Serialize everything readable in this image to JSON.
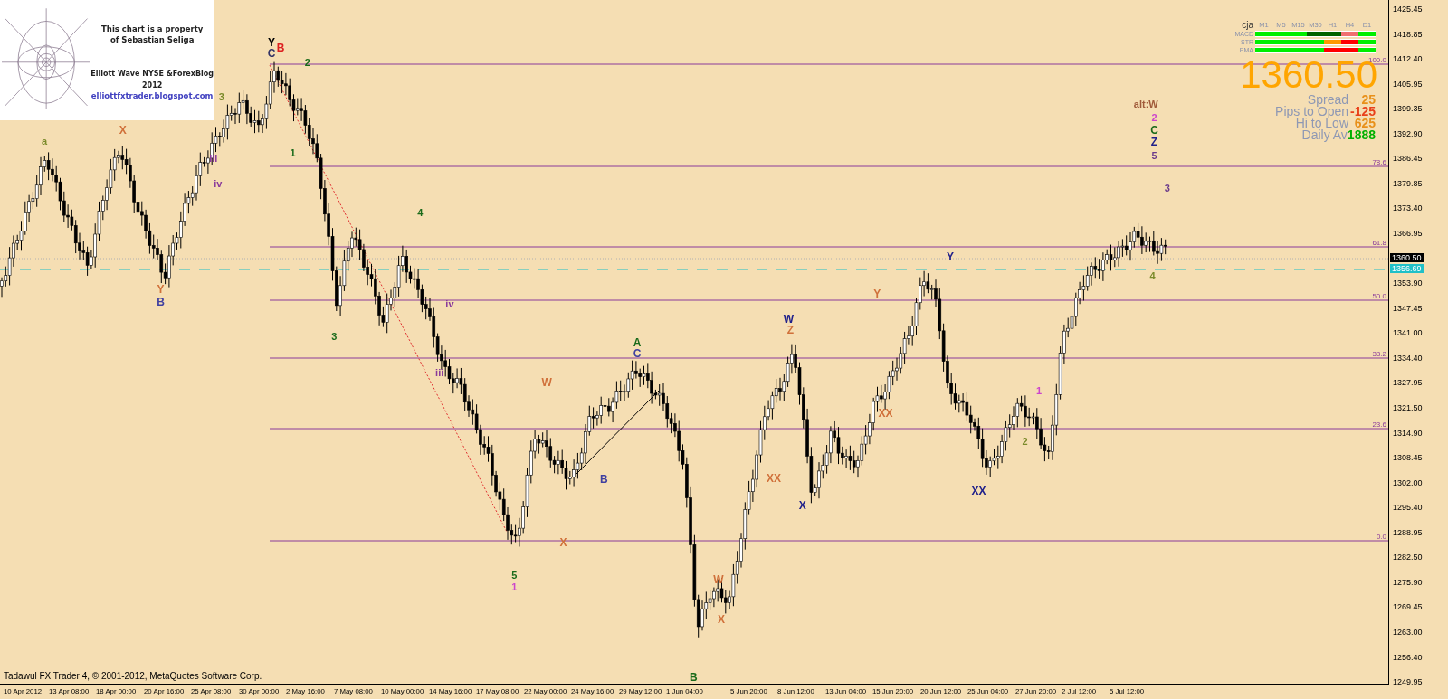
{
  "credit_box": {
    "notice": "This chart is a property of Sebastian Seliga",
    "blog_name": "Elliott Wave NYSE &ForexBlog",
    "year": "2012",
    "url": "elliottfxtrader.blogspot.com"
  },
  "info_panel": {
    "symbol": "cja",
    "timeframes": [
      "M1",
      "M5",
      "M15",
      "M30",
      "H1",
      "H4",
      "D1"
    ],
    "rows": [
      {
        "name": "MACD",
        "cells": [
          {
            "color": "#00ee00"
          },
          {
            "color": "#00ee00"
          },
          {
            "color": "#00ee00"
          },
          {
            "color": "#006400"
          },
          {
            "color": "#006400"
          },
          {
            "color": "#f07070"
          },
          {
            "color": "#00ee00"
          }
        ]
      },
      {
        "name": "STR",
        "cells": [
          {
            "color": "#00ee00"
          },
          {
            "color": "#00ee00"
          },
          {
            "color": "#00ee00"
          },
          {
            "color": "#00ee00"
          },
          {
            "color": "#ff9900"
          },
          {
            "color": "#ff0000"
          },
          {
            "color": "#00ee00"
          }
        ]
      },
      {
        "name": "EMA",
        "cells": [
          {
            "color": "#00ee00"
          },
          {
            "color": "#00ee00"
          },
          {
            "color": "#00ee00"
          },
          {
            "color": "#00ee00"
          },
          {
            "color": "#ff0000"
          },
          {
            "color": "#ff0000"
          },
          {
            "color": "#00ee00"
          }
        ]
      }
    ],
    "price": "1360.50",
    "stats": [
      {
        "label": "Spread",
        "value": "25",
        "color": "#e8901a"
      },
      {
        "label": "Pips to Open",
        "value": "-125",
        "color": "#e8401a"
      },
      {
        "label": "Hi to Low",
        "value": "625",
        "color": "#e8901a"
      },
      {
        "label": "Daily Av",
        "value": "1888",
        "color": "#00b000"
      }
    ]
  },
  "fib_levels": [
    {
      "label": "100.0"
    },
    {
      "label": "78.6"
    },
    {
      "label": "61.8"
    },
    {
      "label": "50.0"
    },
    {
      "label": "38.2"
    },
    {
      "label": "23.6"
    },
    {
      "label": "0.0"
    }
  ],
  "wave_labels": [
    {
      "text": "Y",
      "color": "#000000"
    },
    {
      "text": "B",
      "color": "#dd2020"
    },
    {
      "text": "C",
      "color": "#333366"
    },
    {
      "text": "X",
      "color": "#d0703a"
    },
    {
      "text": "Y",
      "color": "#d0703a"
    },
    {
      "text": "B",
      "color": "#4040a0"
    },
    {
      "text": "a",
      "color": "#7a8a2a"
    },
    {
      "text": "3",
      "color": "#7a8a2a"
    },
    {
      "text": "2",
      "color": "#1a6a1a"
    },
    {
      "text": "1",
      "color": "#1a6a1a"
    },
    {
      "text": "4",
      "color": "#1a6a1a"
    },
    {
      "text": "3",
      "color": "#1a6a1a"
    },
    {
      "text": "5",
      "color": "#1a6a1a"
    },
    {
      "text": "1",
      "color": "#cc44cc"
    },
    {
      "text": "A",
      "color": "#1a6a1a"
    },
    {
      "text": "C",
      "color": "#4040a0"
    },
    {
      "text": "W",
      "color": "#d0703a"
    },
    {
      "text": "X",
      "color": "#d0703a"
    },
    {
      "text": "B",
      "color": "#4040a0"
    },
    {
      "text": "B",
      "color": "#1a6a1a"
    },
    {
      "text": "W",
      "color": "#d0703a"
    },
    {
      "text": "X",
      "color": "#d0703a"
    },
    {
      "text": "W",
      "color": "#20208a"
    },
    {
      "text": "Z",
      "color": "#d0703a"
    },
    {
      "text": "X",
      "color": "#20208a"
    },
    {
      "text": "XX",
      "color": "#d0703a"
    },
    {
      "text": "Y",
      "color": "#20208a"
    },
    {
      "text": "Y",
      "color": "#d0703a"
    },
    {
      "text": "XX",
      "color": "#d0703a"
    },
    {
      "text": "XX",
      "color": "#20208a"
    },
    {
      "text": "alt:W",
      "color": "#a05a3a"
    },
    {
      "text": "2",
      "color": "#cc44cc"
    },
    {
      "text": "C",
      "color": "#1a6a1a"
    },
    {
      "text": "Z",
      "color": "#20208a"
    },
    {
      "text": "5",
      "color": "#6a3a8a"
    },
    {
      "text": "3",
      "color": "#6a3a8a"
    },
    {
      "text": "4",
      "color": "#7a8a2a"
    },
    {
      "text": "iii",
      "color": "#8a3a9a"
    },
    {
      "text": "iv",
      "color": "#8a3a9a"
    },
    {
      "text": "iv",
      "color": "#8a3a9a"
    },
    {
      "text": "iii",
      "color": "#8a3a9a"
    },
    {
      "text": "1",
      "color": "#cc44cc"
    },
    {
      "text": "2",
      "color": "#7a8a2a"
    }
  ],
  "price_axis": {
    "ticks": [
      "1425.45",
      "1418.85",
      "1412.40",
      "1405.95",
      "1399.35",
      "1392.90",
      "1386.45",
      "1379.85",
      "1373.40",
      "1366.95",
      "1353.90",
      "1347.45",
      "1341.00",
      "1334.40",
      "1327.95",
      "1321.50",
      "1314.90",
      "1308.45",
      "1302.00",
      "1295.40",
      "1288.95",
      "1282.50",
      "1275.90",
      "1269.45",
      "1263.00",
      "1256.40",
      "1249.95"
    ],
    "markers": [
      {
        "text": "1360.50",
        "kind": "bid"
      },
      {
        "text": "1356.69",
        "kind": "level"
      }
    ]
  },
  "time_axis": [
    "10 Apr 2012",
    "13 Apr 08:00",
    "18 Apr 00:00",
    "20 Apr 16:00",
    "25 Apr 08:00",
    "30 Apr 00:00",
    "2 May 16:00",
    "7 May 08:00",
    "10 May 00:00",
    "14 May 16:00",
    "17 May 08:00",
    "22 May 00:00",
    "24 May 16:00",
    "29 May 12:00",
    "1 Jun 04:00",
    "5 Jun 20:00",
    "8 Jun 12:00",
    "13 Jun 04:00",
    "15 Jun 20:00",
    "20 Jun 12:00",
    "25 Jun 04:00",
    "27 Jun 20:00",
    "2 Jul 12:00",
    "5 Jul 12:00"
  ],
  "footer": "Tadawul FX Trader 4, © 2001-2012, MetaQuotes Software Corp."
}
